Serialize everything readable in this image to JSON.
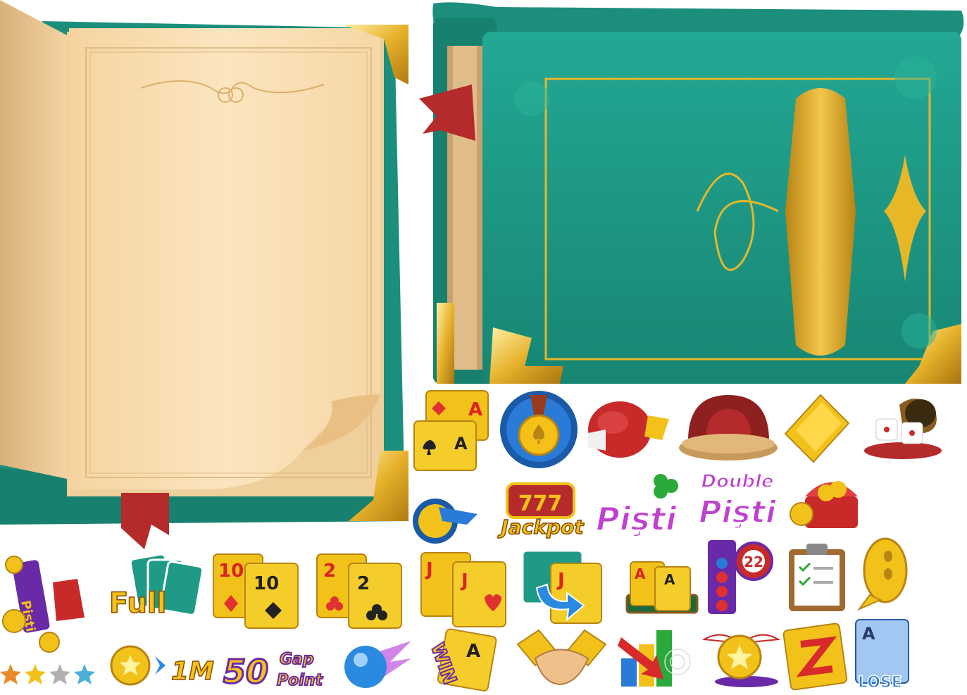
{
  "atlas": {
    "open_book": {
      "has_bookmark": true,
      "page_color": "#f8ddb0",
      "cover_color": "#1f9a86"
    },
    "closed_book": {
      "cover_color": "#1f9a86",
      "gold": "#e8b728"
    },
    "icons": {
      "cards_aa": {
        "rank_top": "A",
        "rank_bottom": "A"
      },
      "jackpot_logo": {
        "digits": "777",
        "word": "Jackpot"
      },
      "pisti_logo": {
        "word": "Pişti"
      },
      "double_pisti_logo": {
        "word_top": "Double",
        "word_bottom": "Pişti"
      },
      "pisti_banner": {
        "word": "Pişti"
      },
      "full_label": {
        "word": "Full"
      },
      "cards_10": {
        "rank": "10"
      },
      "cards_2": {
        "rank": "2"
      },
      "cards_j": {
        "rank": "J"
      },
      "cards_j_swap": {
        "rank": "J"
      },
      "cards_aa_table": {
        "rank": "A"
      },
      "bingo_ball": {
        "number": "22"
      },
      "one_m_label": {
        "text": "1M"
      },
      "gap_point_label": {
        "number": "50",
        "word_top": "Gap",
        "word_bottom": "Point"
      },
      "win_card": {
        "word": "WIN",
        "rank": "A"
      },
      "lose_card": {
        "word": "LOSE",
        "rank": "A"
      }
    },
    "colors": {
      "teal": "#1f9a86",
      "gold": "#f2c21a",
      "red": "#c62a2a",
      "purple": "#8a2bd1"
    }
  }
}
